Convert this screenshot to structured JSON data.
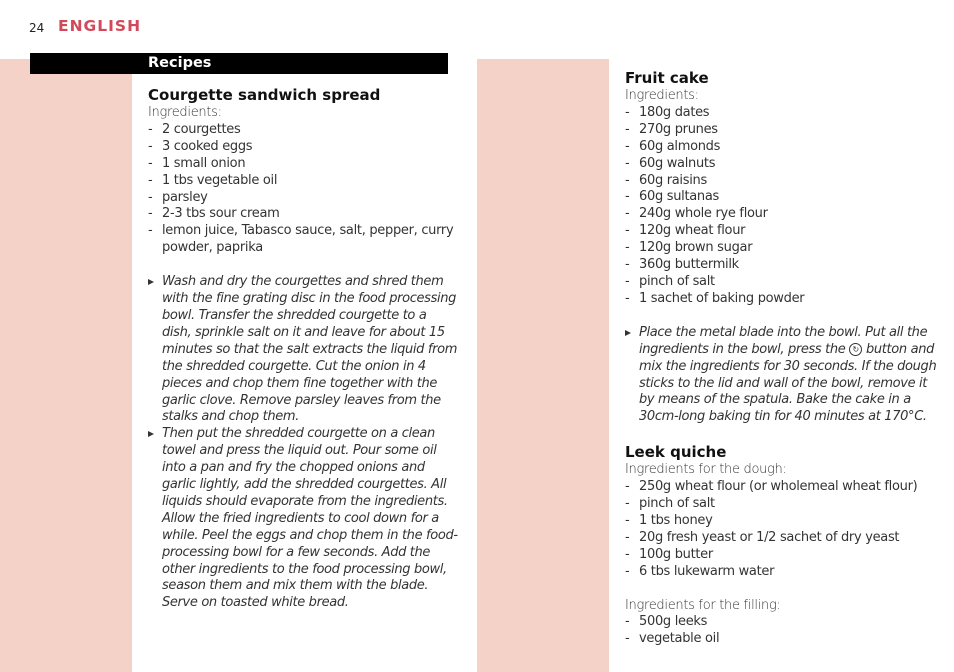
{
  "header": {
    "page_number": "24",
    "language": "ENGLISH"
  },
  "section_title": "Recipes",
  "colors": {
    "accent": "#d2495b",
    "band": "#f5d2c7",
    "bar": "#000000"
  },
  "recipes": [
    {
      "title": "Courgette sandwich spread",
      "ingredients_label": "Ingredients:",
      "ingredients": [
        "2 courgettes",
        "3 cooked eggs",
        "1 small onion",
        "1 tbs vegetable oil",
        "parsley",
        "2-3 tbs sour cream",
        "lemon juice, Tabasco sauce, salt, pepper, curry powder, paprika"
      ],
      "steps": [
        "Wash and dry the courgettes and shred them with the fine grating disc in the food processing bowl. Transfer the shredded courgette to a dish, sprinkle salt on it and leave for about 15 minutes so that the salt extracts the liquid from the shredded courgette. Cut the onion in 4 pieces and chop them fine together with the garlic clove. Remove parsley leaves from the stalks and chop them.",
        "Then put the shredded courgette on a clean towel and press the liquid out. Pour some oil into a pan and fry the chopped onions and garlic lightly, add the shredded courgettes. All liquids should evaporate from the ingredients. Allow the fried ingredients to cool down for a while. Peel the eggs and chop them in the food-processing bowl for a few seconds. Add the other ingredients to the food processing bowl, season them and mix them with the blade. Serve on toasted white bread."
      ]
    },
    {
      "title": "Fruit cake",
      "ingredients_label": "Ingredients:",
      "ingredients": [
        "180g dates",
        "270g prunes",
        "60g almonds",
        "60g walnuts",
        "60g raisins",
        "60g sultanas",
        "240g whole rye flour",
        "120g wheat flour",
        "120g brown sugar",
        "360g buttermilk",
        "pinch of salt",
        "1 sachet of baking powder"
      ],
      "step_parts": {
        "before_icon": "Place the metal blade into the bowl. Put all the ingredients in the bowl, press the",
        "icon": "turbo-button-icon",
        "icon_glyph": "↻",
        "after_icon": "button and mix the ingredients for 30 seconds. If the dough sticks to the lid and wall of the bowl, remove it by means of the spatula. Bake the cake in a 30cm-long baking tin for 40 minutes at 170°C."
      }
    },
    {
      "title": "Leek quiche",
      "dough_label": "Ingredients for the dough:",
      "dough": [
        "250g wheat flour (or wholemeal wheat flour)",
        "pinch of salt",
        "1 tbs honey",
        "20g fresh yeast or 1/2 sachet of dry yeast",
        "100g butter",
        "6 tbs lukewarm water"
      ],
      "filling_label": "Ingredients for the filling:",
      "filling": [
        "500g leeks",
        "vegetable oil"
      ]
    }
  ]
}
